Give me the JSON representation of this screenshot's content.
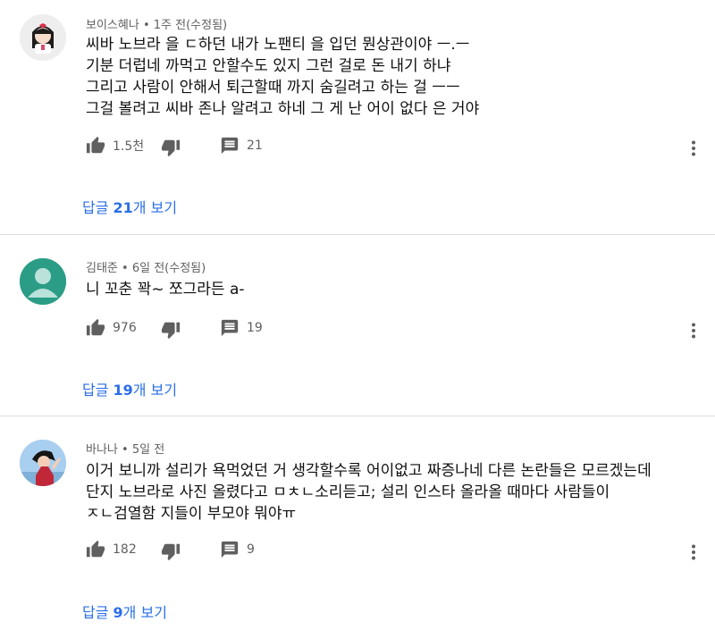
{
  "comments": [
    {
      "author": "보이스혜나",
      "time": "1주 전(수정됨)",
      "lines": [
        "씨바 노브라 을 ㄷ하던 내가 노팬티 을 입던 뭔상관이야 ㅡ.ㅡ",
        "기분 더럽네 까먹고 안할수도 있지 그런 걸로  돈 내기 하냐",
        "그리고 사람이 안해서 퇴근할때 까지 숨길려고 하는 걸 ㅡㅡ",
        "그걸 볼려고 씨바 존나  알려고 하네 그 게 난 어이 없다 은 거야"
      ],
      "likes": "1.5천",
      "reply_count": "21",
      "replies_prefix": "답글 ",
      "replies_num": "21",
      "replies_suffix": "개 보기"
    },
    {
      "author": "김태준",
      "time": "6일 전(수정됨)",
      "lines": [
        "니 꼬춘 꽉~  쪼그라든 a-"
      ],
      "likes": "976",
      "reply_count": "19",
      "replies_prefix": "답글 ",
      "replies_num": "19",
      "replies_suffix": "개 보기"
    },
    {
      "author": "바나나",
      "time": "5일 전",
      "lines": [
        "이거 보니까 설리가 욕먹었던 거 생각할수록 어이없고 짜증나네 다른 논란들은 모르겠는데",
        "단지 노브라로 사진 올렸다고 ㅁㅊㄴ소리듣고; 설리 인스타 올라올 때마다 사람들이",
        "ㅈㄴ검열함 지들이 부모야 뭐야ㅠ"
      ],
      "likes": "182",
      "reply_count": "9",
      "replies_prefix": "답글 ",
      "replies_num": "9",
      "replies_suffix": "개 보기"
    }
  ],
  "icons": {
    "like": "thumb-up-icon",
    "dislike": "thumb-down-icon",
    "reply": "comment-icon",
    "more": "more-vert-icon"
  },
  "colors": {
    "link": "#2a6ee8",
    "meta": "#606060",
    "icon": "#5f5f5f",
    "avatar_default_bg": "#2b9d86"
  }
}
